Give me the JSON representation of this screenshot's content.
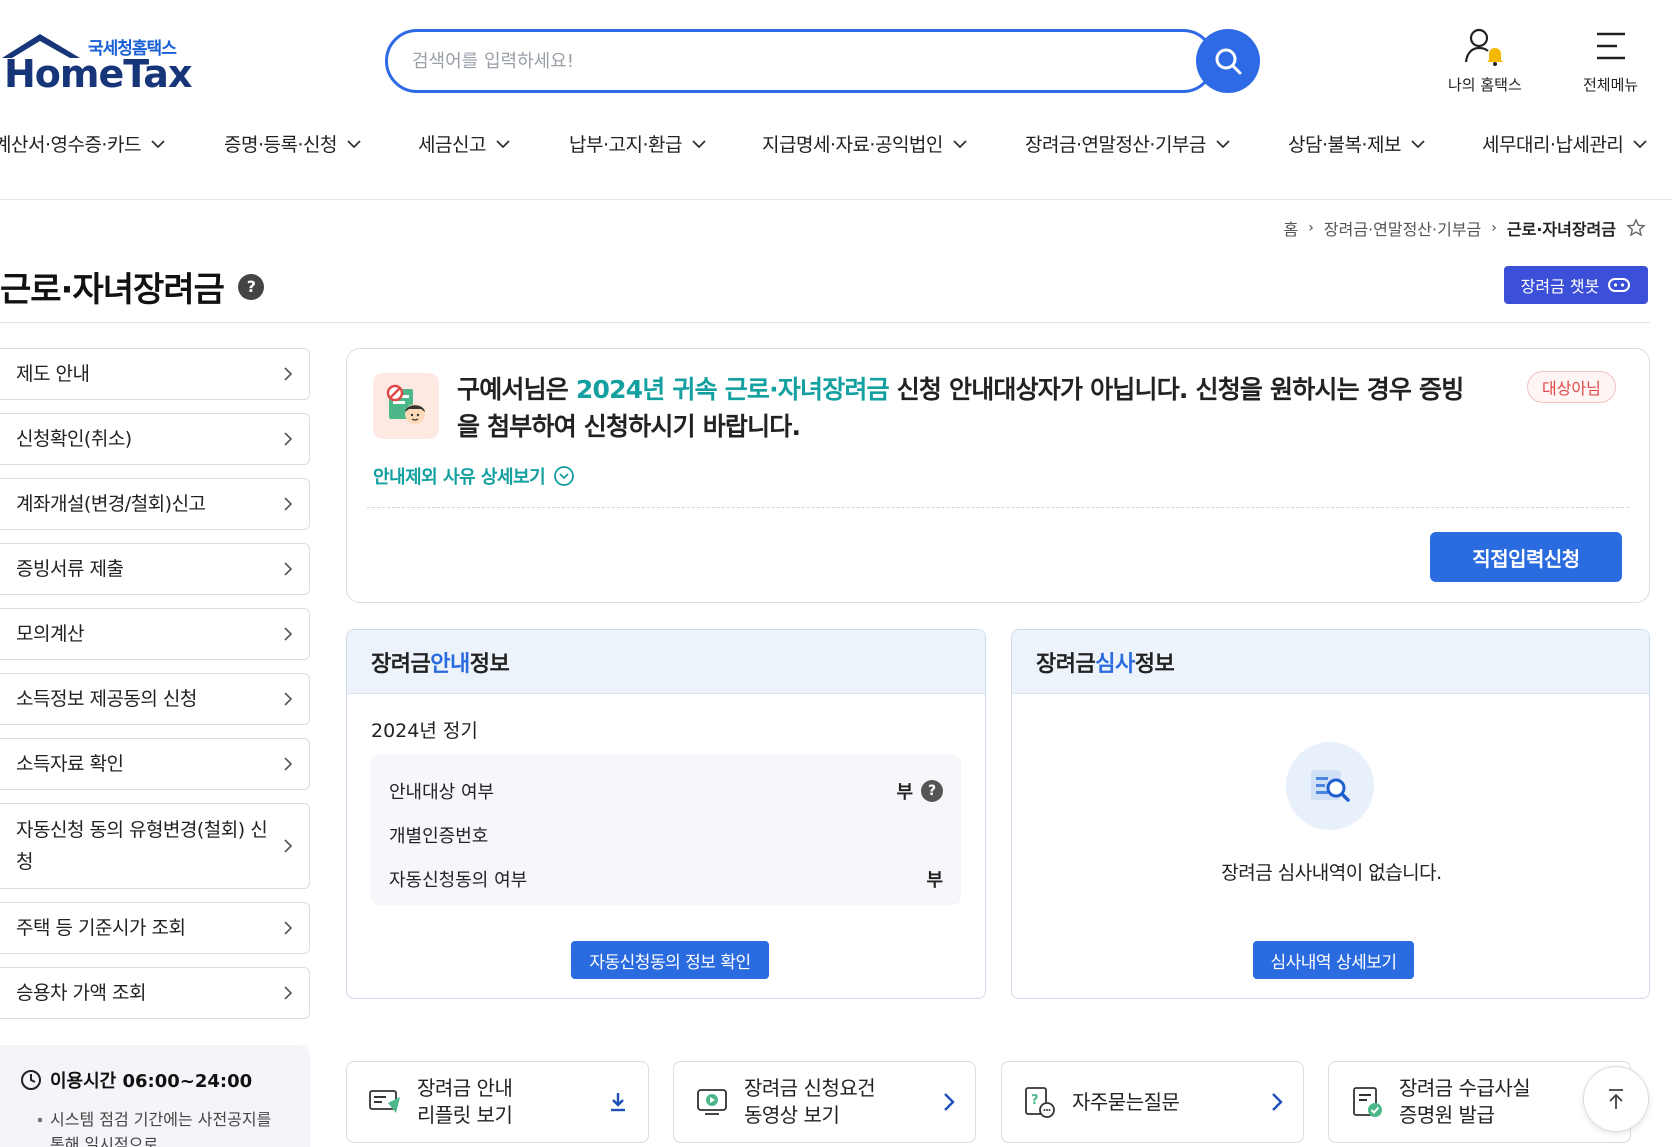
{
  "header": {
    "logo_sub": "국세청홈택스",
    "logo_main": "HomeTax",
    "search_placeholder": "검색어를 입력하세요!",
    "my_hometax": "나의 홈택스",
    "all_menu": "전체메뉴"
  },
  "gnb": [
    "계산서·영수증·카드",
    "증명·등록·신청",
    "세금신고",
    "납부·고지·환급",
    "지급명세·자료·공익법인",
    "장려금·연말정산·기부금",
    "상담·불복·제보",
    "세무대리·납세관리"
  ],
  "breadcrumb": {
    "home": "홈",
    "parent": "장려금·연말정산·기부금",
    "current": "근로·자녀장려금"
  },
  "page_title": "근로·자녀장려금",
  "help_mark": "?",
  "chatbot_label": "장려금 챗봇",
  "lnb": [
    "제도 안내",
    "신청확인(취소)",
    "계좌개설(변경/철회)신고",
    "증빙서류 제출",
    "모의계산",
    "소득정보 제공동의 신청",
    "소득자료 확인",
    "자동신청 동의 유형변경(철회) 신청",
    "주택 등 기준시가 조회",
    "승용차 가액 조회"
  ],
  "time_box": {
    "title": "이용시간 06:00~24:00",
    "desc": "시스템 점검 기간에는 사전공지를 통해 일시적으로"
  },
  "notice": {
    "text_1": "구예서님은 ",
    "text_hl": "2024년 귀속 근로·자녀장려금",
    "text_2": " 신청 안내대상자가 아닙니다. 신청을 원하시는 경우 증빙을 첨부하여 신청하시기 바랍니다.",
    "badge": "대상아님",
    "link": "안내제외 사유 상세보기",
    "direct_btn": "직접입력신청"
  },
  "guide_panel": {
    "title_1": "장려금 ",
    "title_blue": "안내",
    "title_2": " 정보",
    "period": "2024년 정기",
    "rows": [
      {
        "label": "안내대상 여부",
        "value": "부"
      },
      {
        "label": "개별인증번호",
        "value": ""
      },
      {
        "label": "자동신청동의 여부",
        "value": "부"
      }
    ],
    "button": "자동신청동의 정보 확인"
  },
  "review_panel": {
    "title_1": "장려금 ",
    "title_blue": "심사",
    "title_2": " 정보",
    "empty": "장려금 심사내역이 없습니다.",
    "button": "심사내역 상세보기"
  },
  "quick_links": [
    {
      "line1": "장려금 안내",
      "line2": "리플릿 보기"
    },
    {
      "line1": "장려금 신청요건",
      "line2": "동영상 보기"
    },
    {
      "line1": "자주묻는질문",
      "line2": ""
    },
    {
      "line1": "장려금 수급사실",
      "line2": "증명원 발급"
    }
  ],
  "colors": {
    "primary": "#2a6be0",
    "teal": "#14a0a0",
    "navy": "#17367a",
    "chatbot": "#3b4fd8",
    "badge_red": "#e04848"
  }
}
